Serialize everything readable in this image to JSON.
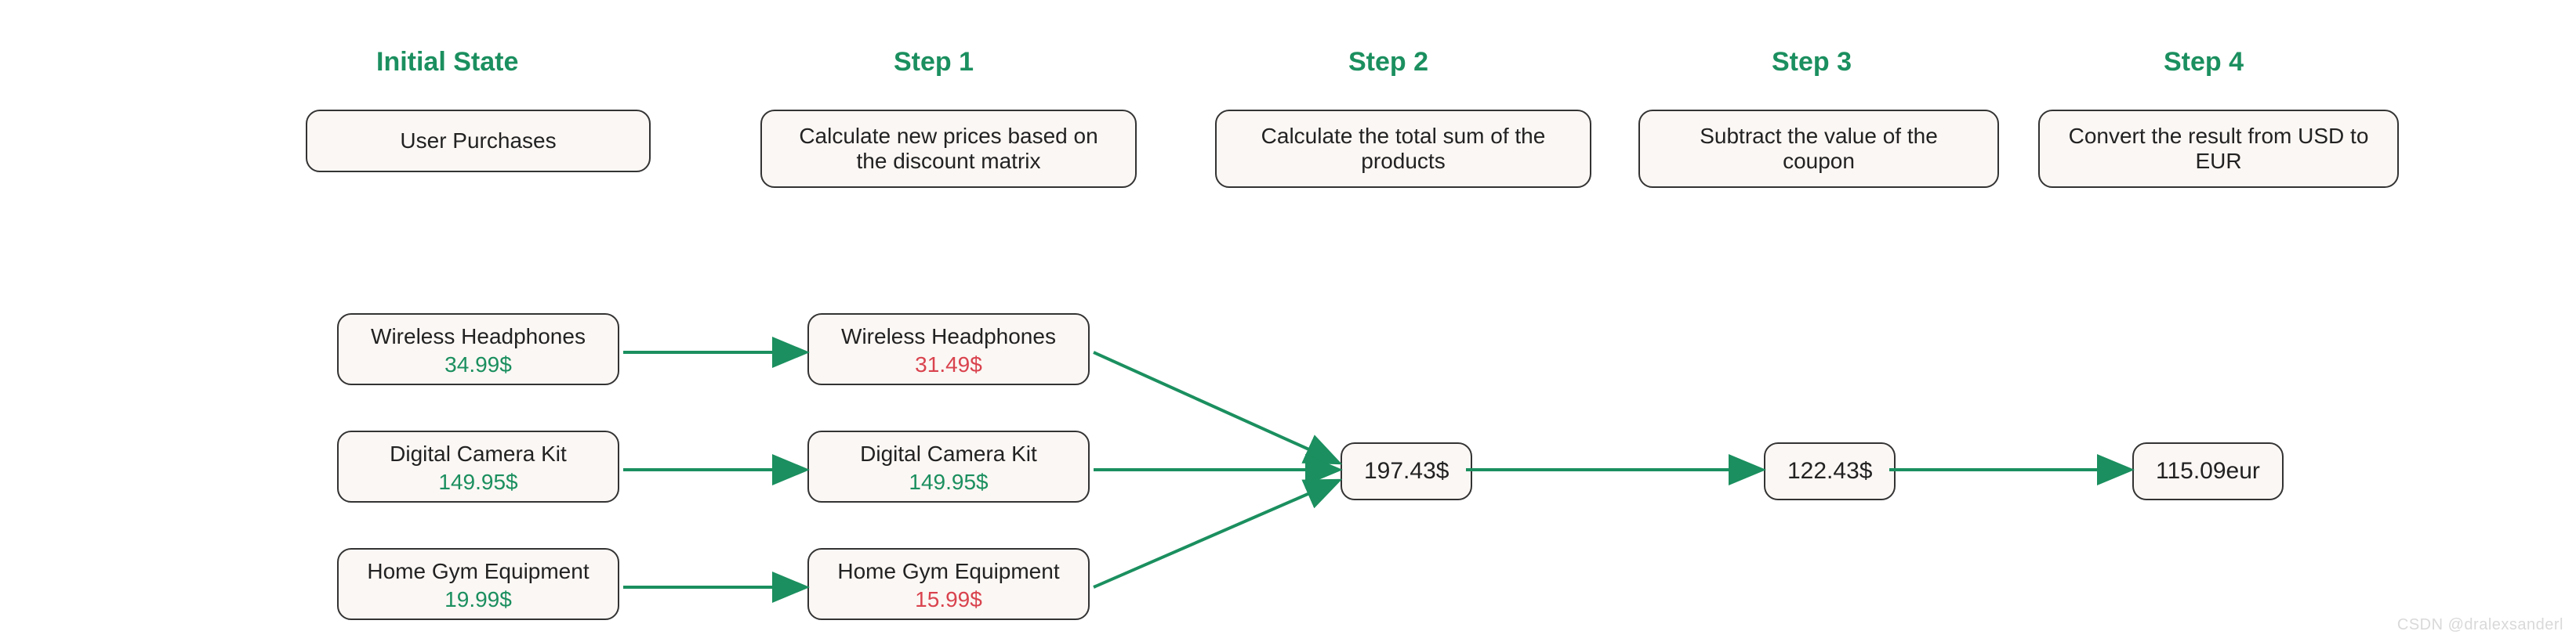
{
  "headers": {
    "initial": "Initial State",
    "step1": "Step 1",
    "step2": "Step 2",
    "step3": "Step 3",
    "step4": "Step 4"
  },
  "steps": {
    "initial_box": "User Purchases",
    "step1_box": "Calculate new prices based on the discount matrix",
    "step2_box": "Calculate the total sum of the products",
    "step3_box": "Subtract the value of the coupon",
    "step4_box": "Convert the result from USD to EUR"
  },
  "initial_products": [
    {
      "name": "Wireless Headphones",
      "price": "34.99$"
    },
    {
      "name": "Digital Camera Kit",
      "price": "149.95$"
    },
    {
      "name": "Home Gym Equipment",
      "price": "19.99$"
    }
  ],
  "step1_products": [
    {
      "name": "Wireless Headphones",
      "price": "31.49$",
      "changed": true
    },
    {
      "name": "Digital Camera Kit",
      "price": "149.95$",
      "changed": false
    },
    {
      "name": "Home Gym Equipment",
      "price": "15.99$",
      "changed": true
    }
  ],
  "values": {
    "step2": "197.43$",
    "step3": "122.43$",
    "step4": "115.09eur"
  },
  "watermark": "CSDN @dralexsanderl"
}
